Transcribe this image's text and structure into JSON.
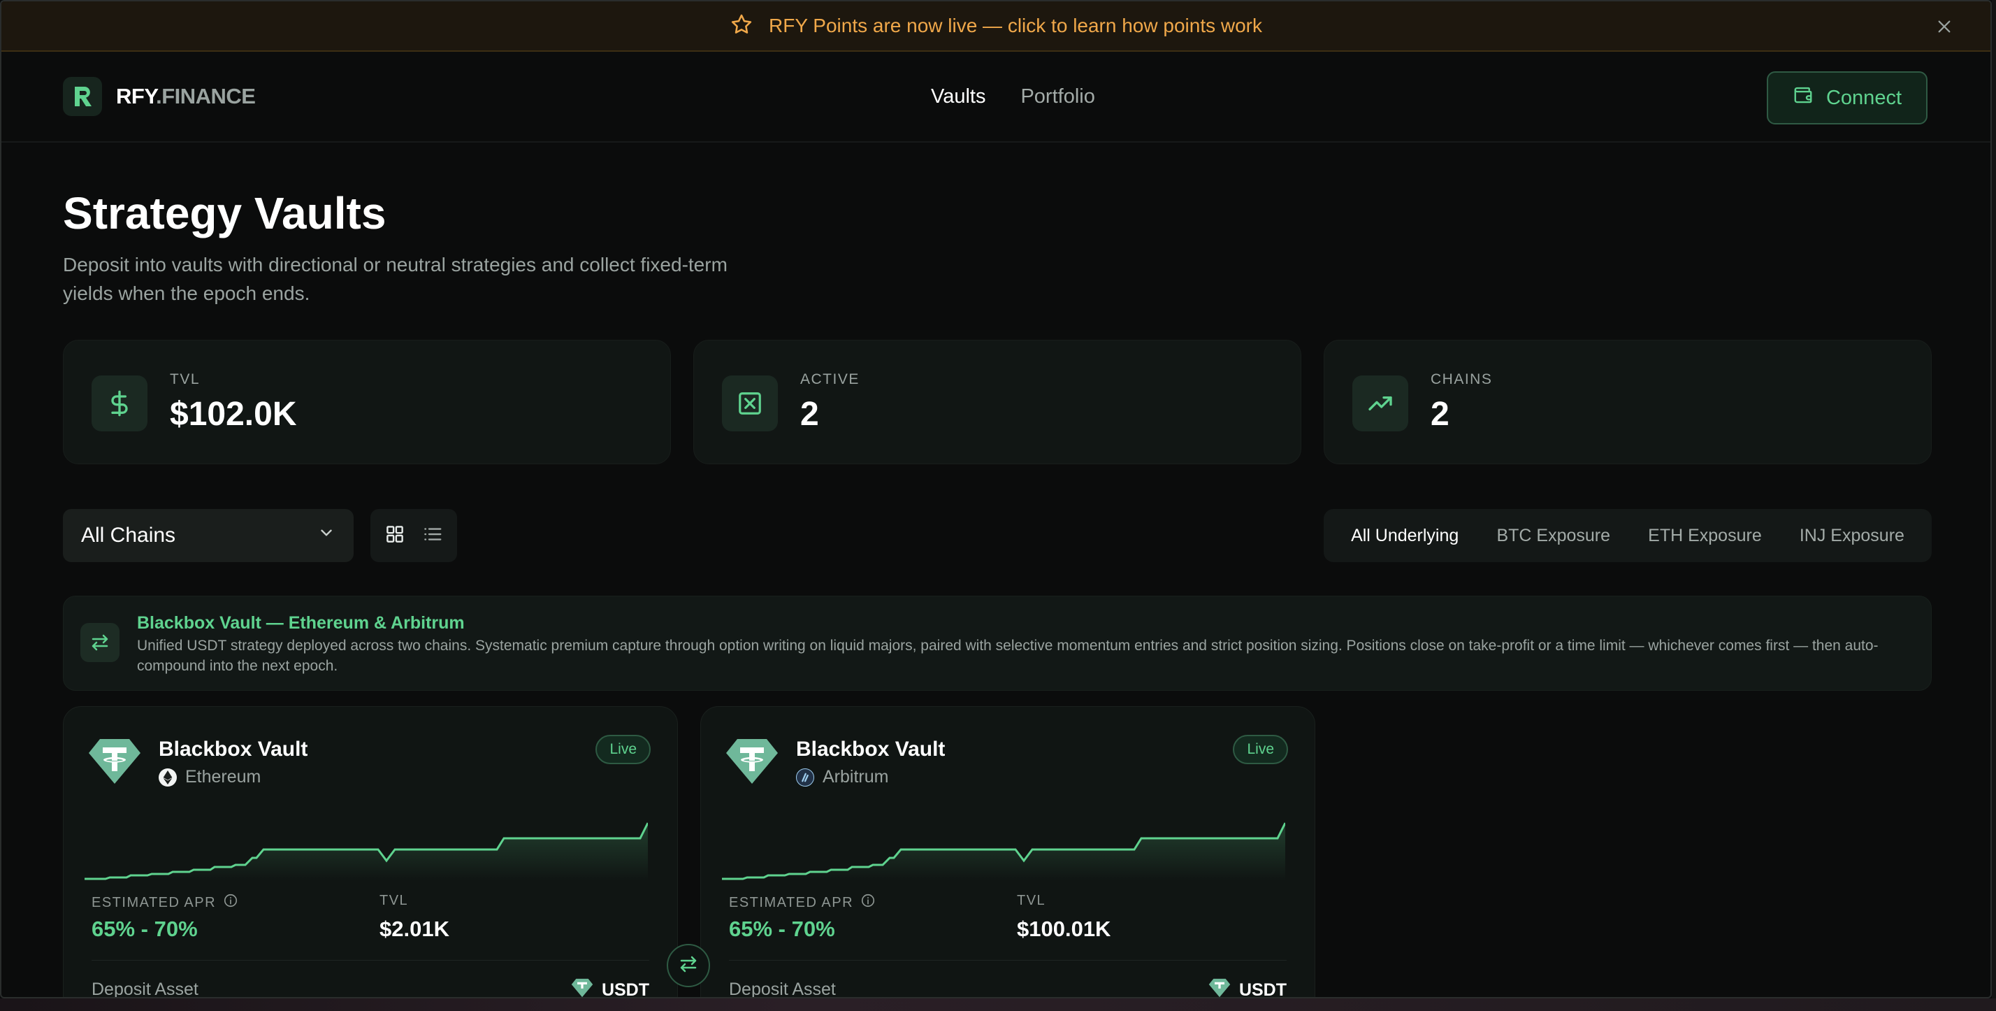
{
  "banner": {
    "text": "RFY Points are now live — click to learn how points work",
    "icon": "star-icon"
  },
  "header": {
    "logo_a": "RFY",
    "logo_b": ".FINANCE",
    "nav": [
      {
        "label": "Vaults",
        "active": true
      },
      {
        "label": "Portfolio",
        "active": false
      }
    ],
    "connect_label": "Connect"
  },
  "page": {
    "title": "Strategy Vaults",
    "subtitle": "Deposit into vaults with directional or neutral strategies and collect fixed-term yields when the epoch ends."
  },
  "stats": [
    {
      "label": "TVL",
      "value": "$102.0K",
      "icon": "dollar-icon"
    },
    {
      "label": "ACTIVE",
      "value": "2",
      "icon": "active-box-icon"
    },
    {
      "label": "CHAINS",
      "value": "2",
      "icon": "trending-up-icon"
    }
  ],
  "filters": {
    "chain_select": "All Chains",
    "underlying_tabs": [
      {
        "label": "All Underlying",
        "active": true
      },
      {
        "label": "BTC Exposure",
        "active": false
      },
      {
        "label": "ETH Exposure",
        "active": false
      },
      {
        "label": "INJ Exposure",
        "active": false
      }
    ]
  },
  "info": {
    "title": "Blackbox Vault — Ethereum & Arbitrum",
    "description": "Unified USDT strategy deployed across two chains. Systematic premium capture through option writing on liquid majors, paired with selective momentum entries and strict position sizing. Positions close on take-profit or a time limit — whichever comes first — then auto-compound into the next epoch."
  },
  "vaults": [
    {
      "name": "Blackbox Vault",
      "chain": "Ethereum",
      "status": "Live",
      "apr_label": "ESTIMATED APR",
      "apr": "65% - 70%",
      "tvl_label": "TVL",
      "tvl": "$2.01K",
      "deposit_label": "Deposit Asset",
      "deposit_asset": "USDT"
    },
    {
      "name": "Blackbox Vault",
      "chain": "Arbitrum",
      "status": "Live",
      "apr_label": "ESTIMATED APR",
      "apr": "65% - 70%",
      "tvl_label": "TVL",
      "tvl": "$100.01K",
      "deposit_label": "Deposit Asset",
      "deposit_asset": "USDT"
    }
  ],
  "colors": {
    "accent": "#5fd38f",
    "banner_text": "#f0a84a",
    "background": "#0b0c0c",
    "card": "#111614"
  }
}
